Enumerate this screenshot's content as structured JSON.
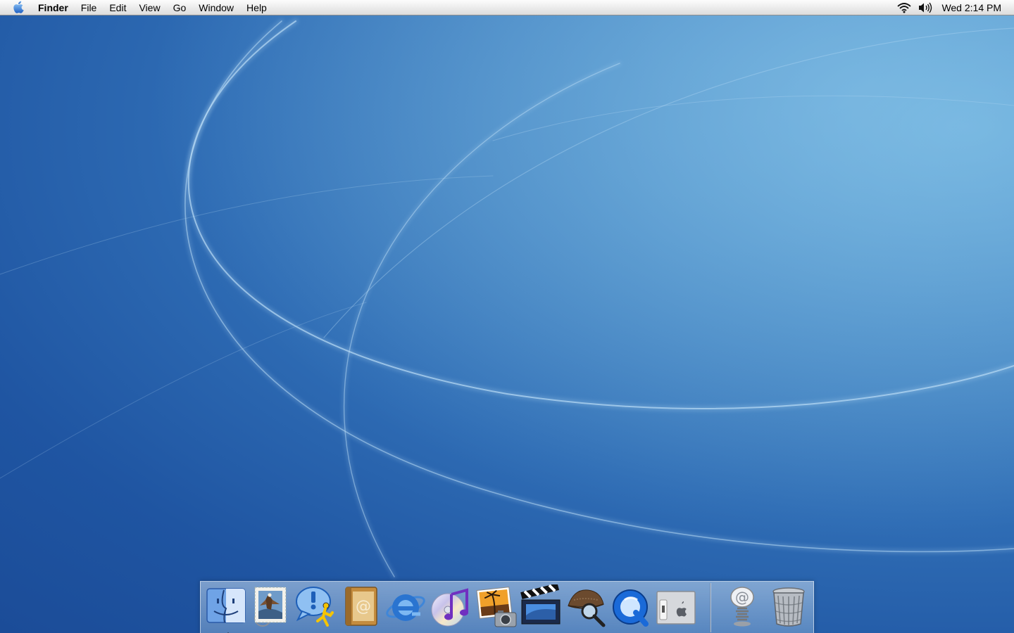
{
  "menubar": {
    "apple_icon": "apple-icon",
    "app_name": "Finder",
    "menus": [
      "File",
      "Edit",
      "View",
      "Go",
      "Window",
      "Help"
    ],
    "status": {
      "wifi_icon": "wifi-icon",
      "volume_icon": "volume-icon",
      "clock": "Wed 2:14 PM"
    }
  },
  "desktop": {
    "wallpaper": "aqua-blue-light-arcs",
    "colors": {
      "deep_blue": "#1b4c98",
      "mid_blue": "#2f6db5",
      "light_blue": "#6aaedb"
    }
  },
  "dock": {
    "apps": [
      {
        "name": "finder",
        "icon": "finder-icon",
        "running": true
      },
      {
        "name": "mail",
        "icon": "mail-stamp-icon",
        "running": false
      },
      {
        "name": "ichat",
        "icon": "ichat-icon",
        "running": false
      },
      {
        "name": "address-book",
        "icon": "address-book-icon",
        "running": false
      },
      {
        "name": "internet-explorer",
        "icon": "internet-explorer-icon",
        "running": false
      },
      {
        "name": "itunes",
        "icon": "itunes-icon",
        "running": false
      },
      {
        "name": "iphoto",
        "icon": "iphoto-icon",
        "running": false
      },
      {
        "name": "imovie",
        "icon": "imovie-icon",
        "running": false
      },
      {
        "name": "sherlock",
        "icon": "sherlock-icon",
        "running": false
      },
      {
        "name": "quicktime",
        "icon": "quicktime-icon",
        "running": false
      },
      {
        "name": "system-preferences",
        "icon": "system-preferences-icon",
        "running": false
      }
    ],
    "others": [
      {
        "name": "internet-location",
        "icon": "at-spring-icon"
      },
      {
        "name": "trash",
        "icon": "trash-icon"
      }
    ]
  }
}
